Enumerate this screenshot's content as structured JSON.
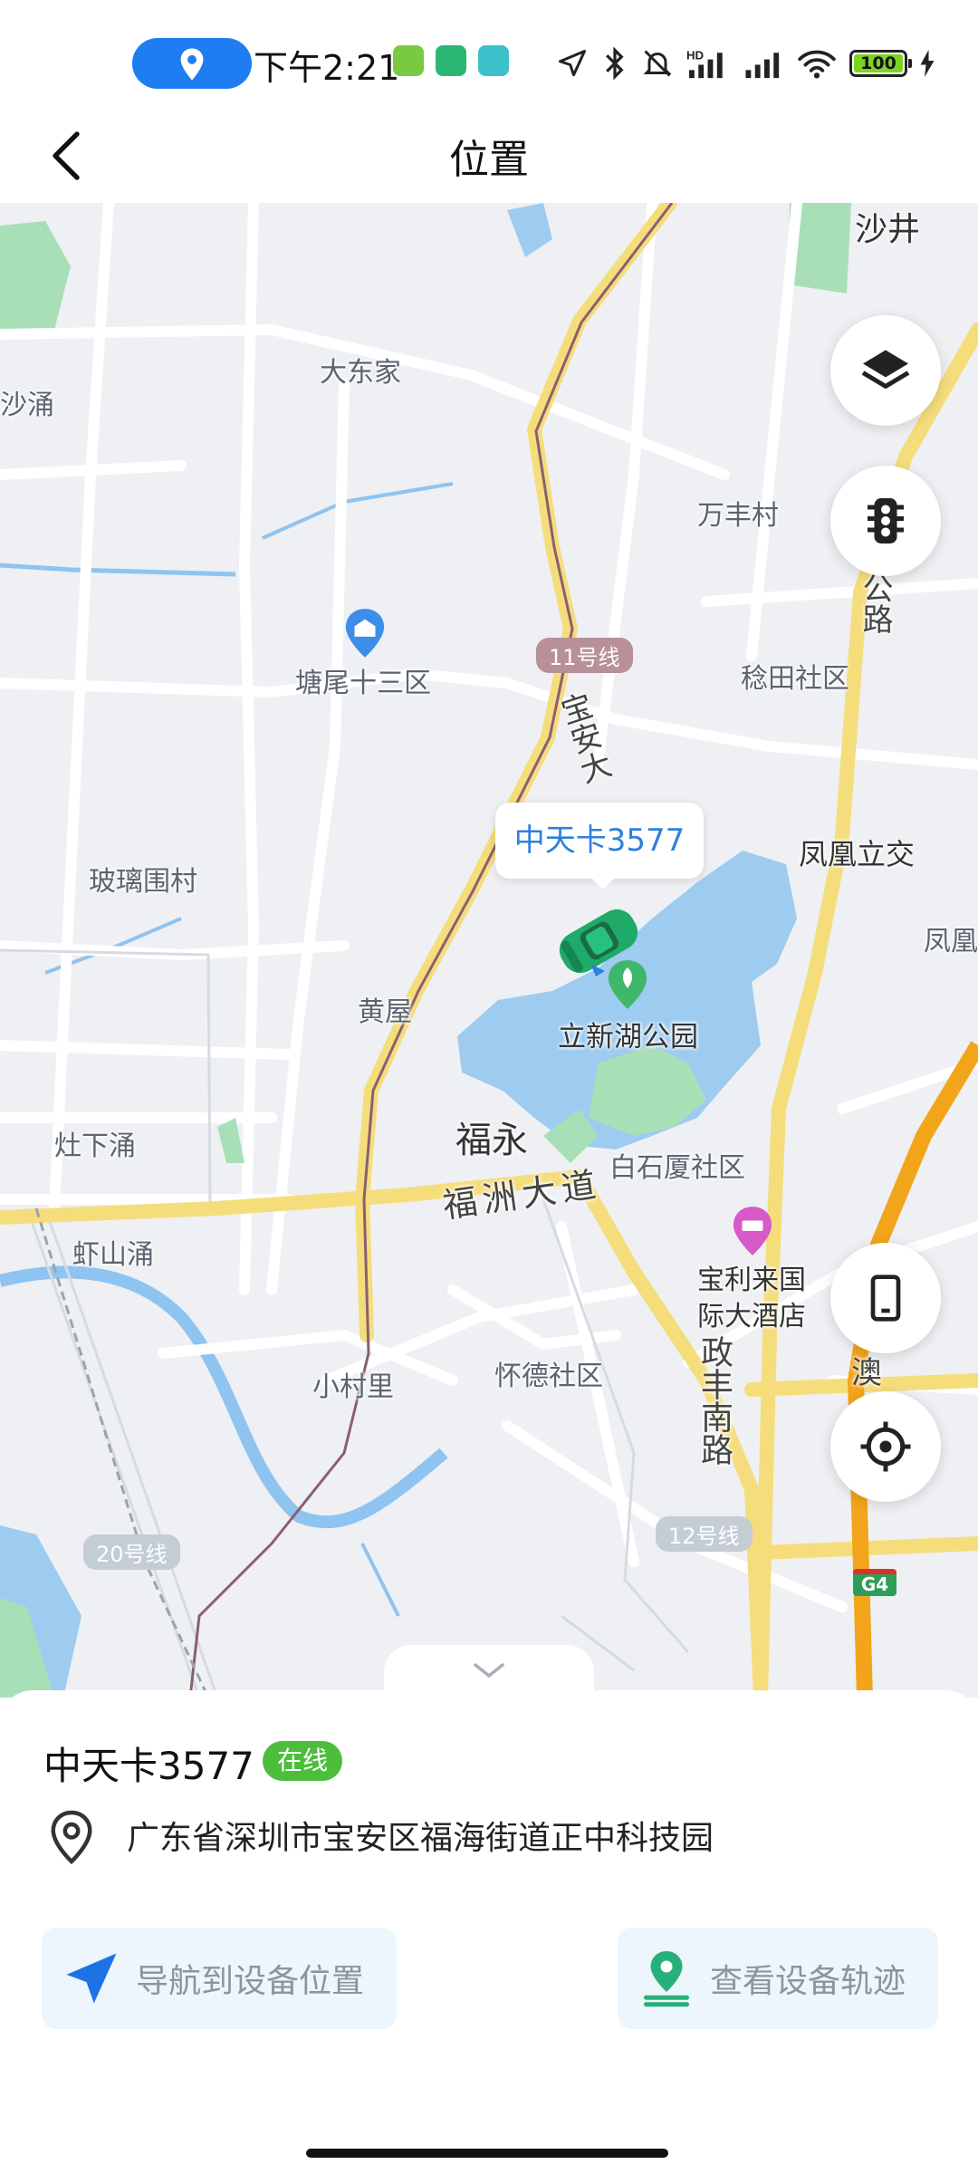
{
  "status_bar": {
    "time": "下午2:21",
    "battery": "100",
    "colors": {
      "location_pill": "#1e7df0",
      "battery_fill": "#7ed321"
    }
  },
  "header": {
    "title": "位置"
  },
  "map": {
    "places": {
      "shajing": "沙井",
      "dadongjia": "大东家",
      "shayong": "沙涌",
      "wanfengcun": "万丰村",
      "tangwei": "塘尾十三区",
      "rentian": "稔田社区",
      "bolitun": "玻璃围村",
      "fenghuang_lijiao": "凤凰立交",
      "fenghuang": "凤凰",
      "huangwu": "黄屋",
      "lixinhu": "立新湖公园",
      "fuyong": "福永",
      "baishixia": "白石厦社区",
      "zaoxiayong": "灶下涌",
      "xiashanyong": "虾山涌",
      "baoli_hotel_1": "宝利来国",
      "baoli_hotel_2": "际大酒店",
      "xiaocunli": "小村里",
      "huaide": "怀德社区",
      "ao": "澳"
    },
    "roads": {
      "baoan": "宝安大",
      "gong_road": "公路",
      "fuzhou": "福洲大道",
      "zhengfeng": "政丰南路"
    },
    "metro": {
      "line11": "11号线",
      "line20": "20号线",
      "line12": "12号线"
    },
    "highway_shield": "G4",
    "device_bubble": "中天卡3577"
  },
  "sheet": {
    "device_name": "中天卡3577",
    "status_badge": "在线",
    "address": "广东省深圳市宝安区福海街道正中科技园",
    "navigate_label": "导航到设备位置",
    "track_label": "查看设备轨迹",
    "colors": {
      "online_badge": "#4cbe3c",
      "button_bg": "#edf5fd",
      "nav_icon": "#1f72e6",
      "track_icon": "#27b07a"
    }
  }
}
